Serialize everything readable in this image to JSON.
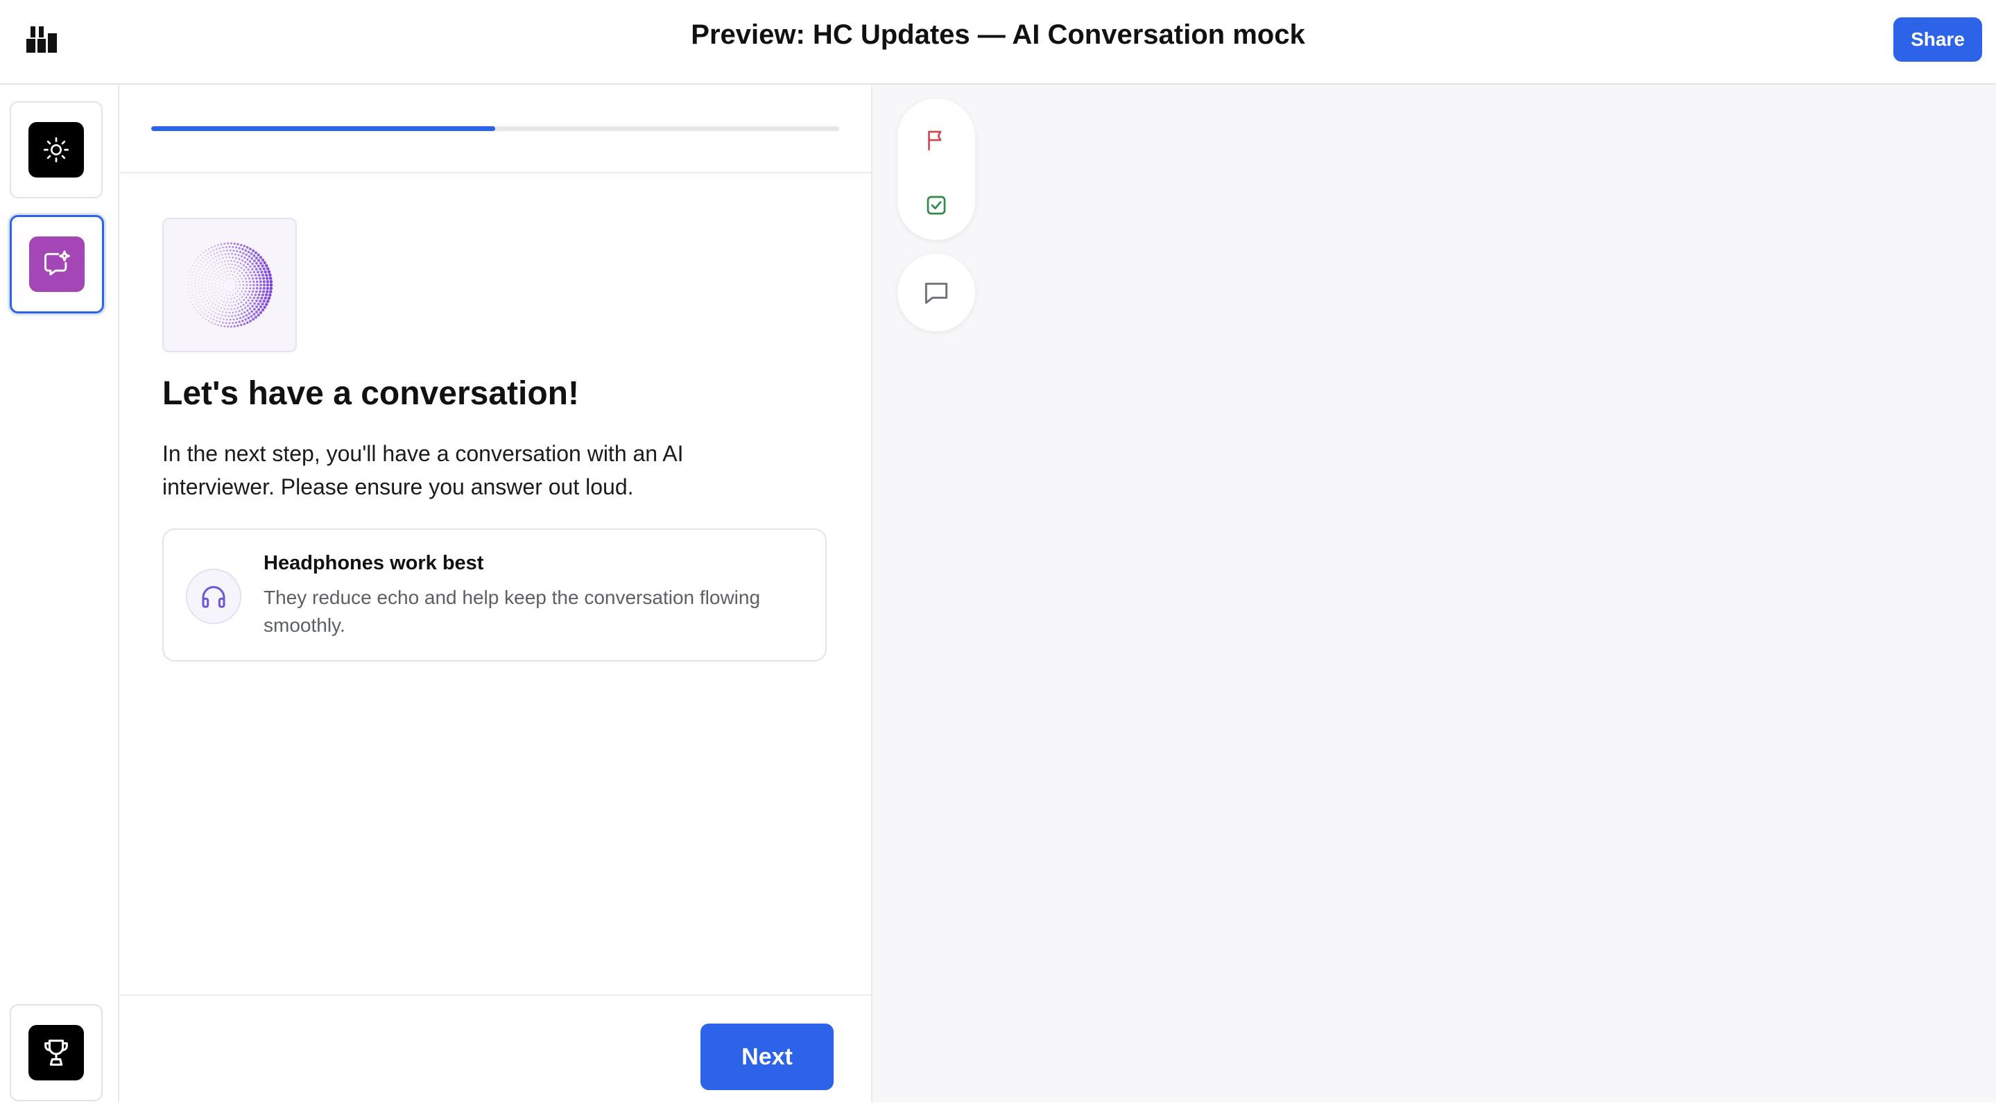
{
  "header": {
    "title": "Preview: HC Updates — AI Conversation mock",
    "share_label": "Share"
  },
  "sidebar": {
    "items": [
      {
        "icon": "sun-icon",
        "state": "default"
      },
      {
        "icon": "chat-sparkle-icon",
        "state": "selected"
      },
      {
        "icon": "trophy-icon",
        "state": "default"
      }
    ]
  },
  "step": {
    "progress": 0.5,
    "heading": "Let's have a conversation!",
    "intro": "In the next step, you'll have a conversation with an AI interviewer. Please ensure you answer out loud.",
    "tip": {
      "icon": "headphones-icon",
      "title": "Headphones work best",
      "description": "They reduce echo and help keep the conversation flowing smoothly."
    },
    "next_label": "Next"
  },
  "toolbar": {
    "icons": [
      "flag-icon",
      "check-square-icon",
      "comment-icon"
    ]
  },
  "colors": {
    "accent": "#2d63e8",
    "chat_tile": "#a546b6",
    "flag": "#d04a54",
    "check": "#2f8a4a",
    "orb": "#7b3fd9"
  }
}
